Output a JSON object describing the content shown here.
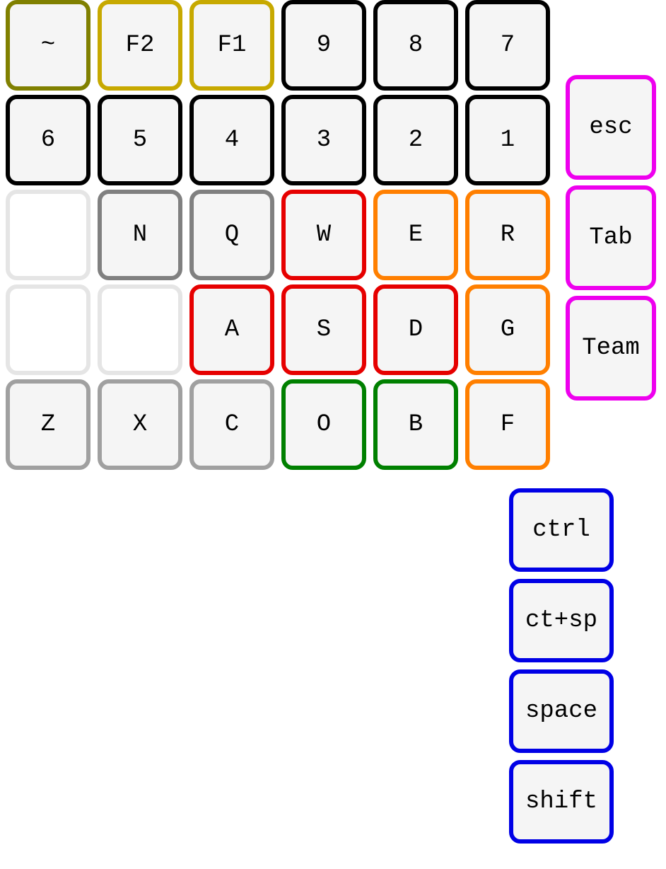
{
  "colors": {
    "olive": "#808000",
    "gold": "#c7a900",
    "black": "#000000",
    "lightgray": "#e5e5e5",
    "gray": "#808080",
    "mediumgray": "#a0a0a0",
    "red": "#e60000",
    "orange": "#ff7f00",
    "green": "#008000",
    "magenta": "#ee00ee",
    "blue": "#0000e6",
    "keyfill": "#f5f5f5"
  },
  "row1": [
    {
      "label": "~",
      "color": "olive"
    },
    {
      "label": "F2",
      "color": "gold"
    },
    {
      "label": "F1",
      "color": "gold"
    },
    {
      "label": "9",
      "color": "black"
    },
    {
      "label": "8",
      "color": "black"
    },
    {
      "label": "7",
      "color": "black"
    }
  ],
  "row2": [
    {
      "label": "6",
      "color": "black"
    },
    {
      "label": "5",
      "color": "black"
    },
    {
      "label": "4",
      "color": "black"
    },
    {
      "label": "3",
      "color": "black"
    },
    {
      "label": "2",
      "color": "black"
    },
    {
      "label": "1",
      "color": "black"
    }
  ],
  "row3": [
    {
      "label": "",
      "color": "lightgray"
    },
    {
      "label": "N",
      "color": "gray"
    },
    {
      "label": "Q",
      "color": "gray"
    },
    {
      "label": "W",
      "color": "red"
    },
    {
      "label": "E",
      "color": "orange"
    },
    {
      "label": "R",
      "color": "orange"
    }
  ],
  "row4": [
    {
      "label": "",
      "color": "lightgray"
    },
    {
      "label": "",
      "color": "lightgray"
    },
    {
      "label": "A",
      "color": "red"
    },
    {
      "label": "S",
      "color": "red"
    },
    {
      "label": "D",
      "color": "red"
    },
    {
      "label": "G",
      "color": "orange"
    }
  ],
  "row5": [
    {
      "label": "Z",
      "color": "mediumgray"
    },
    {
      "label": "X",
      "color": "mediumgray"
    },
    {
      "label": "C",
      "color": "mediumgray"
    },
    {
      "label": "O",
      "color": "green"
    },
    {
      "label": "B",
      "color": "green"
    },
    {
      "label": "F",
      "color": "orange"
    }
  ],
  "rightMagenta": [
    {
      "label": "esc",
      "color": "magenta"
    },
    {
      "label": "Tab",
      "color": "magenta"
    },
    {
      "label": "Team",
      "color": "magenta"
    }
  ],
  "blueColumn": [
    {
      "label": "ctrl",
      "color": "blue"
    },
    {
      "label": "ct+sp",
      "color": "blue"
    },
    {
      "label": "space",
      "color": "blue"
    },
    {
      "label": "shift",
      "color": "blue"
    }
  ]
}
